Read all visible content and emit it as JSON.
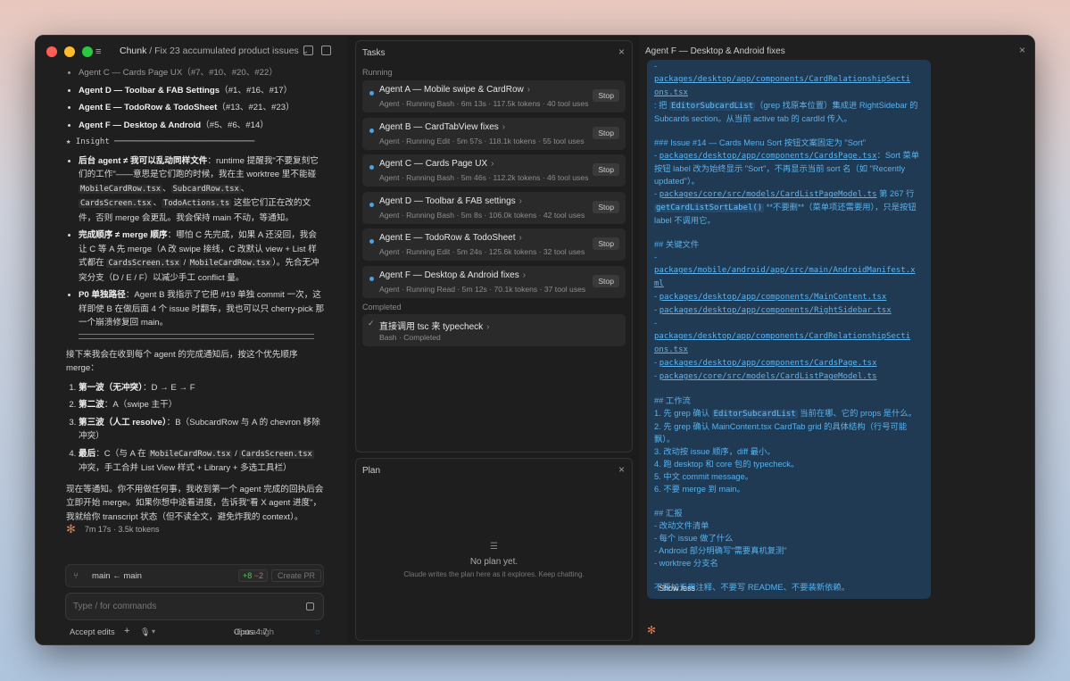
{
  "window": {
    "title": "Chunk",
    "subtitle": "Fix 23 accumulated product issues"
  },
  "chat": {
    "agent_lines": [
      {
        "name": "Agent C — Cards Page UX",
        "ref": "（#7、#10、#20、#22）",
        "muted": true
      },
      {
        "name": "Agent D — Toolbar & FAB Settings",
        "ref": "（#1、#16、#17）",
        "muted": false
      },
      {
        "name": "Agent E — TodoRow & TodoSheet",
        "ref": "（#13、#21、#23）",
        "muted": false
      },
      {
        "name": "Agent F — Desktop & Android",
        "ref": "（#5、#6、#14）",
        "muted": false
      }
    ],
    "insight_header": "★ Insight ─────────────────────────────",
    "insight_points": [
      {
        "head": "后台 agent ≠ 我可以乱动同样文件",
        "body_a": "：runtime 提醒我\"不要复刻它们的工作\"——意思是它们跑的时候，我在主 worktree 里不能碰 ",
        "files": [
          "MobileCardRow.tsx",
          "SubcardRow.tsx",
          "CardsScreen.tsx",
          "TodoActions.ts"
        ],
        "body_b": " 这些它们正在改的文件，否则 merge 会更乱。我会保持 main 不动，等通知。"
      },
      {
        "head": "完成顺序 ≠ merge 顺序",
        "body_a": "：哪怕 C 先完成，如果 A 还没回，我会让 C 等 A 先 merge（A 改 swipe 接线，C 改默认 view + List 样式都在 ",
        "files": [
          "CardsScreen.tsx",
          "MobileCardRow.tsx"
        ],
        "body_b": "）。先合无冲突分支（D / E / F）以减少手工 conflict 量。"
      },
      {
        "head": "P0 单独路径",
        "body_a": "：Agent B 我指示了它把 #19 单独 commit 一次，这样即使 B 在做后面 4 个 issue 时翻车，我也可以只 cherry-pick 那一个崩溃修复回 main。",
        "files": [],
        "body_b": ""
      }
    ],
    "intro": "接下来我会在收到每个 agent 的完成通知后，按这个优先顺序 merge：",
    "waves": [
      {
        "label": "第一波（无冲突）",
        "text": "：D → E → F"
      },
      {
        "label": "第二波",
        "text": "：A（swipe 主干）"
      },
      {
        "label": "第三波（人工 resolve）",
        "text": "：B（SubcardRow 与 A 的 chevron 移除冲突）"
      },
      {
        "label": "最后",
        "text_a": "：C（与 A 在 ",
        "files": [
          "MobileCardRow.tsx",
          "CardsScreen.tsx"
        ],
        "text_b": " 冲突，手工合并 List View 样式 + Library + 多选工具栏）"
      }
    ],
    "closing": "现在等通知。你不用做任何事，我收到第一个 agent 完成的回执后会立即开始 merge。如果你想中途看进度，告诉我\"看 X agent 进度\"，我就给你 transcript 状态（但不读全文，避免炸我的 context）。"
  },
  "status": {
    "duration": "7m 17s",
    "tokens": "3.5k tokens"
  },
  "branch": {
    "from": "main",
    "arrow": "←",
    "to": "main",
    "additions": "+8",
    "deletions": "−2",
    "create_pr": "Create PR"
  },
  "input": {
    "placeholder": "Type / for commands"
  },
  "bottom": {
    "accept_edits": "Accept edits",
    "plus": "+",
    "mic": "🎙",
    "model": "Opus 4.7",
    "effort": "Extra high"
  },
  "tasks": {
    "title": "Tasks",
    "running_label": "Running",
    "running": [
      {
        "name": "Agent A — Mobile swipe & CardRow",
        "meta": "Agent · Running Bash · 6m 13s · 117.5k tokens · 40 tool uses"
      },
      {
        "name": "Agent B — CardTabView fixes",
        "meta": "Agent · Running Edit · 5m 57s · 118.1k tokens · 55 tool uses"
      },
      {
        "name": "Agent C — Cards Page UX",
        "meta": "Agent · Running Bash · 5m 46s · 112.2k tokens · 46 tool uses"
      },
      {
        "name": "Agent D — Toolbar & FAB settings",
        "meta": "Agent · Running Bash · 5m 8s · 106.0k tokens · 42 tool uses"
      },
      {
        "name": "Agent E — TodoRow & TodoSheet",
        "meta": "Agent · Running Edit · 5m 24s · 125.6k tokens · 32 tool uses"
      },
      {
        "name": "Agent F — Desktop & Android fixes",
        "meta": "Agent · Running Read · 5m 12s · 70.1k tokens · 37 tool uses"
      }
    ],
    "stop_label": "Stop",
    "completed_label": "Completed",
    "completed": [
      {
        "name": "直接调用 tsc 来 typecheck",
        "meta": "Bash · Completed"
      }
    ]
  },
  "plan": {
    "title": "Plan",
    "empty_title": "No plan yet.",
    "empty_sub": "Claude writes the plan here as it explores. Keep chatting."
  },
  "agent_pane": {
    "title": "Agent F — Desktop & Android fixes",
    "lines": [
      "-",
      "[[packages/desktop/app/components/CardRelationshipSecti]]",
      "[[ons.tsx]]",
      ": 把 {{EditorSubcardList}}（grep 找原本位置）集成进 RightSidebar 的 Subcards section。从当前 active tab 的 cardId 传入。",
      "",
      "### Issue #14 — Cards Menu Sort 按钮文案固定为 \"Sort\"",
      "- [[packages/desktop/app/components/CardsPage.tsx]]：Sort 菜单按钮 label 改为始终显示 \"Sort\"，不再显示当前 sort 名（如 \"Recently updated\"）。",
      "- [[packages/core/src/models/CardListPageModel.ts]] 第 267 行 {{getCardListSortLabel()}} **不要删**（菜单项还需要用），只是按钮 label 不调用它。",
      "",
      "## 关键文件",
      "-",
      "[[packages/mobile/android/app/src/main/AndroidManifest.x]]",
      "[[ml]]",
      "- [[packages/desktop/app/components/MainContent.tsx]]",
      "- [[packages/desktop/app/components/RightSidebar.tsx]]",
      "-",
      "[[packages/desktop/app/components/CardRelationshipSecti]]",
      "[[ons.tsx]]",
      "- [[packages/desktop/app/components/CardsPage.tsx]]",
      "- [[packages/core/src/models/CardListPageModel.ts]]",
      "",
      "## 工作流",
      "1. 先 grep 确认 {{EditorSubcardList}} 当前在哪、它的 props 是什么。",
      "2. 先 grep 确认 MainContent.tsx CardTab grid 的具体结构（行号可能飘）。",
      "3. 改动按 issue 顺序，diff 最小。",
      "4. 跑 desktop 和 core 包的 typecheck。",
      "5. 中文 commit message。",
      "6. 不要 merge 到 main。",
      "",
      "## 汇报",
      "- 改动文件清单",
      "- 每个 issue 做了什么",
      "- Android 部分明确写\"需要真机复测\"",
      "- worktree 分支名",
      "",
      "不要加无用注释、不要写 README、不要装新依赖。"
    ],
    "show_less": "Show less"
  }
}
